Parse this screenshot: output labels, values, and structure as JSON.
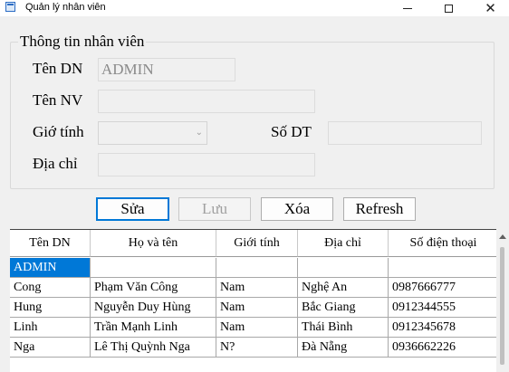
{
  "window": {
    "title": "Quản lý nhân viên",
    "app_icon": "form-icon",
    "controls": {
      "minimize": "minimize-icon",
      "maximize": "maximize-icon",
      "close": "✕"
    }
  },
  "group": {
    "title": "Thông tin nhân viên",
    "fields": {
      "ten_dn": {
        "label": "Tên DN",
        "value": "ADMIN"
      },
      "ten_nv": {
        "label": "Tên NV",
        "value": ""
      },
      "gioi_tinh": {
        "label": "Giớ tính",
        "value": ""
      },
      "so_dt": {
        "label": "Số DT",
        "value": ""
      },
      "dia_chi": {
        "label": "Địa chỉ",
        "value": ""
      }
    }
  },
  "buttons": {
    "sua": "Sửa",
    "luu": "Lưu",
    "xoa": "Xóa",
    "refresh": "Refresh"
  },
  "grid": {
    "columns": [
      "Tên DN",
      "Họ và tên",
      "Giới tính",
      "Địa chỉ",
      "Số điện thoại"
    ],
    "rows": [
      [
        "ADMIN",
        "",
        "",
        "",
        ""
      ],
      [
        "Cong",
        "Phạm Văn Công",
        "Nam",
        "Nghệ An",
        "0987666777"
      ],
      [
        "Hung",
        "Nguyễn Duy Hùng",
        "Nam",
        "Bắc Giang",
        "0912344555"
      ],
      [
        "Linh",
        "Trần Mạnh Linh",
        "Nam",
        "Thái Bình",
        "0912345678"
      ],
      [
        "Nga",
        "Lê Thị Quỳnh Nga",
        "N?",
        "Đà Nẵng",
        "0936662226"
      ]
    ],
    "selected_row": 0
  },
  "colors": {
    "selection": "#0078d7",
    "primary_border": "#0078d7"
  }
}
